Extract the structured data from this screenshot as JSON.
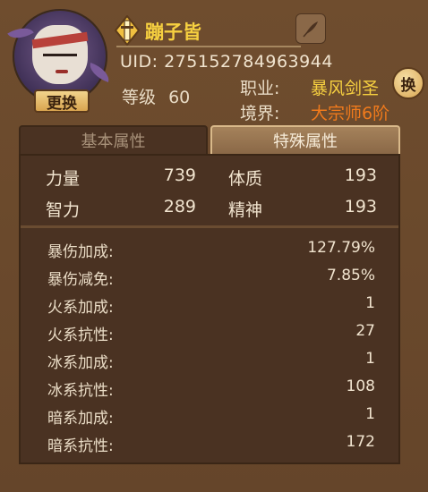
{
  "profile": {
    "name": "蹦子皆",
    "uid": "UID: 275152784963944",
    "level_label": "等级",
    "level_value": "60",
    "job_label": "职业:",
    "job_value": "暴风剑圣",
    "realm_label": "境界:",
    "realm_value": "大宗师6阶",
    "swap_avatar_label": "更换",
    "change_job_label": "换"
  },
  "tabs": [
    {
      "label": "基本属性",
      "active": false
    },
    {
      "label": "特殊属性",
      "active": true
    }
  ],
  "core_stats": [
    {
      "label": "力量",
      "value": "739"
    },
    {
      "label": "体质",
      "value": "193"
    },
    {
      "label": "智力",
      "value": "289"
    },
    {
      "label": "精神",
      "value": "193"
    }
  ],
  "special_stats": [
    {
      "label": "暴伤加成:",
      "value": "127.79%"
    },
    {
      "label": "暴伤减免:",
      "value": "7.85%"
    },
    {
      "label": "火系加成:",
      "value": "1"
    },
    {
      "label": "火系抗性:",
      "value": "27"
    },
    {
      "label": "冰系加成:",
      "value": "1"
    },
    {
      "label": "冰系抗性:",
      "value": "108"
    },
    {
      "label": "暗系加成:",
      "value": "1"
    },
    {
      "label": "暗系抗性:",
      "value": "172"
    }
  ],
  "colors": {
    "name": "#f6d040",
    "job": "#f6d040",
    "realm": "#f07a1c",
    "background": "#6b4a2c",
    "panel": "#4a3222"
  },
  "icons": {
    "rank": "sword-rank-icon",
    "edit": "quill-icon"
  }
}
